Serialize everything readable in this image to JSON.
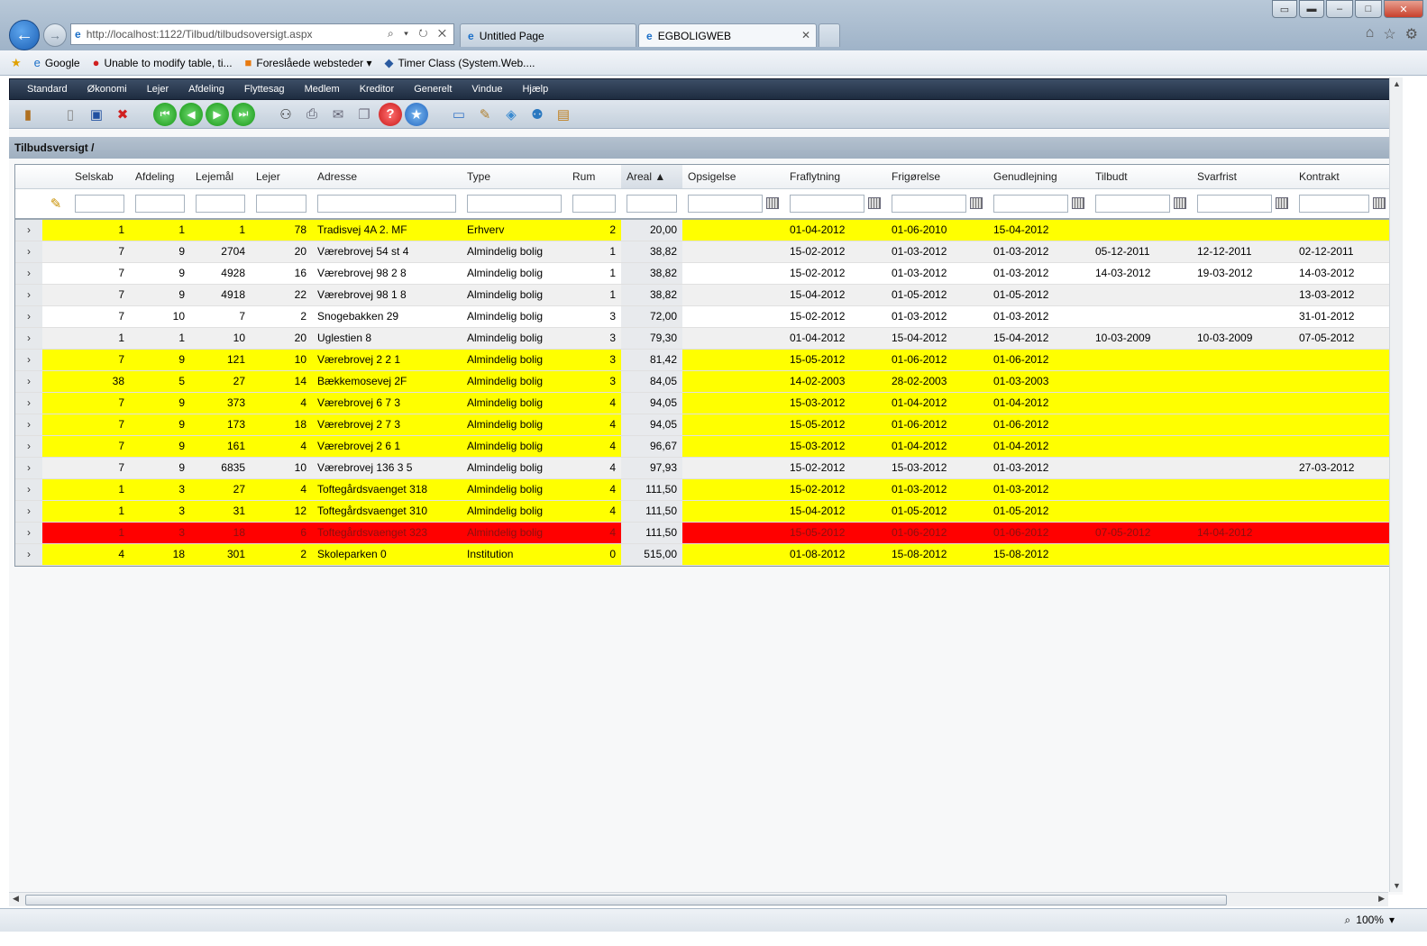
{
  "browser": {
    "window_buttons": [
      "▭",
      "▬",
      "–",
      "□",
      "✕"
    ],
    "back_symbol": "←",
    "forward_symbol": "→",
    "address": "http://localhost:1122/Tilbud/tilbudsoversigt.aspx",
    "address_controls": "⌕ ▾ ↻ ✕",
    "tabs": [
      {
        "label": "Untitled Page"
      },
      {
        "label": "EGBOLIGWEB",
        "close": "✕"
      }
    ],
    "favorites": [
      {
        "label": "Google"
      },
      {
        "label": "Unable to modify table, ti..."
      },
      {
        "label": "Foreslåede websteder ▾"
      },
      {
        "label": "Timer Class (System.Web...."
      }
    ],
    "zoom": "100%"
  },
  "menu": {
    "items": [
      "Standard",
      "Økonomi",
      "Lejer",
      "Afdeling",
      "Flyttesag",
      "Medlem",
      "Kreditor",
      "Generelt",
      "Vindue",
      "Hjælp"
    ]
  },
  "section": {
    "title": "Tilbudsversigt /"
  },
  "grid": {
    "columns": [
      "Selskab",
      "Afdeling",
      "Lejemål",
      "Lejer",
      "Adresse",
      "Type",
      "Rum",
      "Areal ▲",
      "Opsigelse",
      "Fraflytning",
      "Frigørelse",
      "Genudlejning",
      "Tilbudt",
      "Svarfrist",
      "Kontrakt"
    ],
    "sorted_column": "Areal",
    "row_colors": {
      "yellow": "#ffff00",
      "red": "#ff0000",
      "white": "#ffffff",
      "grey": "#f0f0f0"
    },
    "rows": [
      {
        "color": "yellow",
        "selskab": "1",
        "afdeling": "1",
        "lejemaal": "1",
        "lejer": "78",
        "adresse": "Tradisvej 4A 2. MF",
        "type": "Erhverv",
        "rum": "2",
        "areal": "20,00",
        "opsigelse": "",
        "fraflytning": "01-04-2012",
        "frigoerelse": "01-06-2010",
        "genudlejning": "15-04-2012",
        "tilbudt": "",
        "svarfrist": "",
        "kontrakt": ""
      },
      {
        "color": "grey",
        "selskab": "7",
        "afdeling": "9",
        "lejemaal": "2704",
        "lejer": "20",
        "adresse": "Værebrovej 54 st 4",
        "type": "Almindelig bolig",
        "rum": "1",
        "areal": "38,82",
        "opsigelse": "",
        "fraflytning": "15-02-2012",
        "frigoerelse": "01-03-2012",
        "genudlejning": "01-03-2012",
        "tilbudt": "05-12-2011",
        "svarfrist": "12-12-2011",
        "kontrakt": "02-12-2011"
      },
      {
        "color": "white",
        "selskab": "7",
        "afdeling": "9",
        "lejemaal": "4928",
        "lejer": "16",
        "adresse": "Værebrovej 98 2 8",
        "type": "Almindelig bolig",
        "rum": "1",
        "areal": "38,82",
        "opsigelse": "",
        "fraflytning": "15-02-2012",
        "frigoerelse": "01-03-2012",
        "genudlejning": "01-03-2012",
        "tilbudt": "14-03-2012",
        "svarfrist": "19-03-2012",
        "kontrakt": "14-03-2012"
      },
      {
        "color": "grey",
        "selskab": "7",
        "afdeling": "9",
        "lejemaal": "4918",
        "lejer": "22",
        "adresse": "Værebrovej 98 1 8",
        "type": "Almindelig bolig",
        "rum": "1",
        "areal": "38,82",
        "opsigelse": "",
        "fraflytning": "15-04-2012",
        "frigoerelse": "01-05-2012",
        "genudlejning": "01-05-2012",
        "tilbudt": "",
        "svarfrist": "",
        "kontrakt": "13-03-2012"
      },
      {
        "color": "white",
        "selskab": "7",
        "afdeling": "10",
        "lejemaal": "7",
        "lejer": "2",
        "adresse": "Snogebakken 29",
        "type": "Almindelig bolig",
        "rum": "3",
        "areal": "72,00",
        "opsigelse": "",
        "fraflytning": "15-02-2012",
        "frigoerelse": "01-03-2012",
        "genudlejning": "01-03-2012",
        "tilbudt": "",
        "svarfrist": "",
        "kontrakt": "31-01-2012"
      },
      {
        "color": "grey",
        "selskab": "1",
        "afdeling": "1",
        "lejemaal": "10",
        "lejer": "20",
        "adresse": "Uglestien 8",
        "type": "Almindelig bolig",
        "rum": "3",
        "areal": "79,30",
        "opsigelse": "",
        "fraflytning": "01-04-2012",
        "frigoerelse": "15-04-2012",
        "genudlejning": "15-04-2012",
        "tilbudt": "10-03-2009",
        "svarfrist": "10-03-2009",
        "kontrakt": "07-05-2012"
      },
      {
        "color": "yellow",
        "selskab": "7",
        "afdeling": "9",
        "lejemaal": "121",
        "lejer": "10",
        "adresse": "Værebrovej 2 2 1",
        "type": "Almindelig bolig",
        "rum": "3",
        "areal": "81,42",
        "opsigelse": "",
        "fraflytning": "15-05-2012",
        "frigoerelse": "01-06-2012",
        "genudlejning": "01-06-2012",
        "tilbudt": "",
        "svarfrist": "",
        "kontrakt": ""
      },
      {
        "color": "yellow",
        "selskab": "38",
        "afdeling": "5",
        "lejemaal": "27",
        "lejer": "14",
        "adresse": "Bækkemosevej 2F",
        "type": "Almindelig bolig",
        "rum": "3",
        "areal": "84,05",
        "opsigelse": "",
        "fraflytning": "14-02-2003",
        "frigoerelse": "28-02-2003",
        "genudlejning": "01-03-2003",
        "tilbudt": "",
        "svarfrist": "",
        "kontrakt": ""
      },
      {
        "color": "yellow",
        "selskab": "7",
        "afdeling": "9",
        "lejemaal": "373",
        "lejer": "4",
        "adresse": "Værebrovej 6 7 3",
        "type": "Almindelig bolig",
        "rum": "4",
        "areal": "94,05",
        "opsigelse": "",
        "fraflytning": "15-03-2012",
        "frigoerelse": "01-04-2012",
        "genudlejning": "01-04-2012",
        "tilbudt": "",
        "svarfrist": "",
        "kontrakt": ""
      },
      {
        "color": "yellow",
        "selskab": "7",
        "afdeling": "9",
        "lejemaal": "173",
        "lejer": "18",
        "adresse": "Værebrovej 2 7 3",
        "type": "Almindelig bolig",
        "rum": "4",
        "areal": "94,05",
        "opsigelse": "",
        "fraflytning": "15-05-2012",
        "frigoerelse": "01-06-2012",
        "genudlejning": "01-06-2012",
        "tilbudt": "",
        "svarfrist": "",
        "kontrakt": ""
      },
      {
        "color": "yellow",
        "selskab": "7",
        "afdeling": "9",
        "lejemaal": "161",
        "lejer": "4",
        "adresse": "Værebrovej 2 6 1",
        "type": "Almindelig bolig",
        "rum": "4",
        "areal": "96,67",
        "opsigelse": "",
        "fraflytning": "15-03-2012",
        "frigoerelse": "01-04-2012",
        "genudlejning": "01-04-2012",
        "tilbudt": "",
        "svarfrist": "",
        "kontrakt": ""
      },
      {
        "color": "grey",
        "selskab": "7",
        "afdeling": "9",
        "lejemaal": "6835",
        "lejer": "10",
        "adresse": "Værebrovej 136 3 5",
        "type": "Almindelig bolig",
        "rum": "4",
        "areal": "97,93",
        "opsigelse": "",
        "fraflytning": "15-02-2012",
        "frigoerelse": "15-03-2012",
        "genudlejning": "01-03-2012",
        "tilbudt": "",
        "svarfrist": "",
        "kontrakt": "27-03-2012"
      },
      {
        "color": "yellow",
        "selskab": "1",
        "afdeling": "3",
        "lejemaal": "27",
        "lejer": "4",
        "adresse": "Toftegårdsvaenget 318",
        "type": "Almindelig bolig",
        "rum": "4",
        "areal": "111,50",
        "opsigelse": "",
        "fraflytning": "15-02-2012",
        "frigoerelse": "01-03-2012",
        "genudlejning": "01-03-2012",
        "tilbudt": "",
        "svarfrist": "",
        "kontrakt": ""
      },
      {
        "color": "yellow",
        "selskab": "1",
        "afdeling": "3",
        "lejemaal": "31",
        "lejer": "12",
        "adresse": "Toftegårdsvaenget 310",
        "type": "Almindelig bolig",
        "rum": "4",
        "areal": "111,50",
        "opsigelse": "",
        "fraflytning": "15-04-2012",
        "frigoerelse": "01-05-2012",
        "genudlejning": "01-05-2012",
        "tilbudt": "",
        "svarfrist": "",
        "kontrakt": ""
      },
      {
        "color": "red",
        "selskab": "1",
        "afdeling": "3",
        "lejemaal": "18",
        "lejer": "6",
        "adresse": "Toftegårdsvaenget 323",
        "type": "Almindelig bolig",
        "rum": "4",
        "areal": "111,50",
        "opsigelse": "",
        "fraflytning": "15-05-2012",
        "frigoerelse": "01-06-2012",
        "genudlejning": "01-06-2012",
        "tilbudt": "07-05-2012",
        "svarfrist": "14-04-2012",
        "kontrakt": ""
      },
      {
        "color": "yellow",
        "selskab": "4",
        "afdeling": "18",
        "lejemaal": "301",
        "lejer": "2",
        "adresse": "Skoleparken 0",
        "type": "Institution",
        "rum": "0",
        "areal": "515,00",
        "opsigelse": "",
        "fraflytning": "01-08-2012",
        "frigoerelse": "15-08-2012",
        "genudlejning": "15-08-2012",
        "tilbudt": "",
        "svarfrist": "",
        "kontrakt": ""
      }
    ]
  }
}
